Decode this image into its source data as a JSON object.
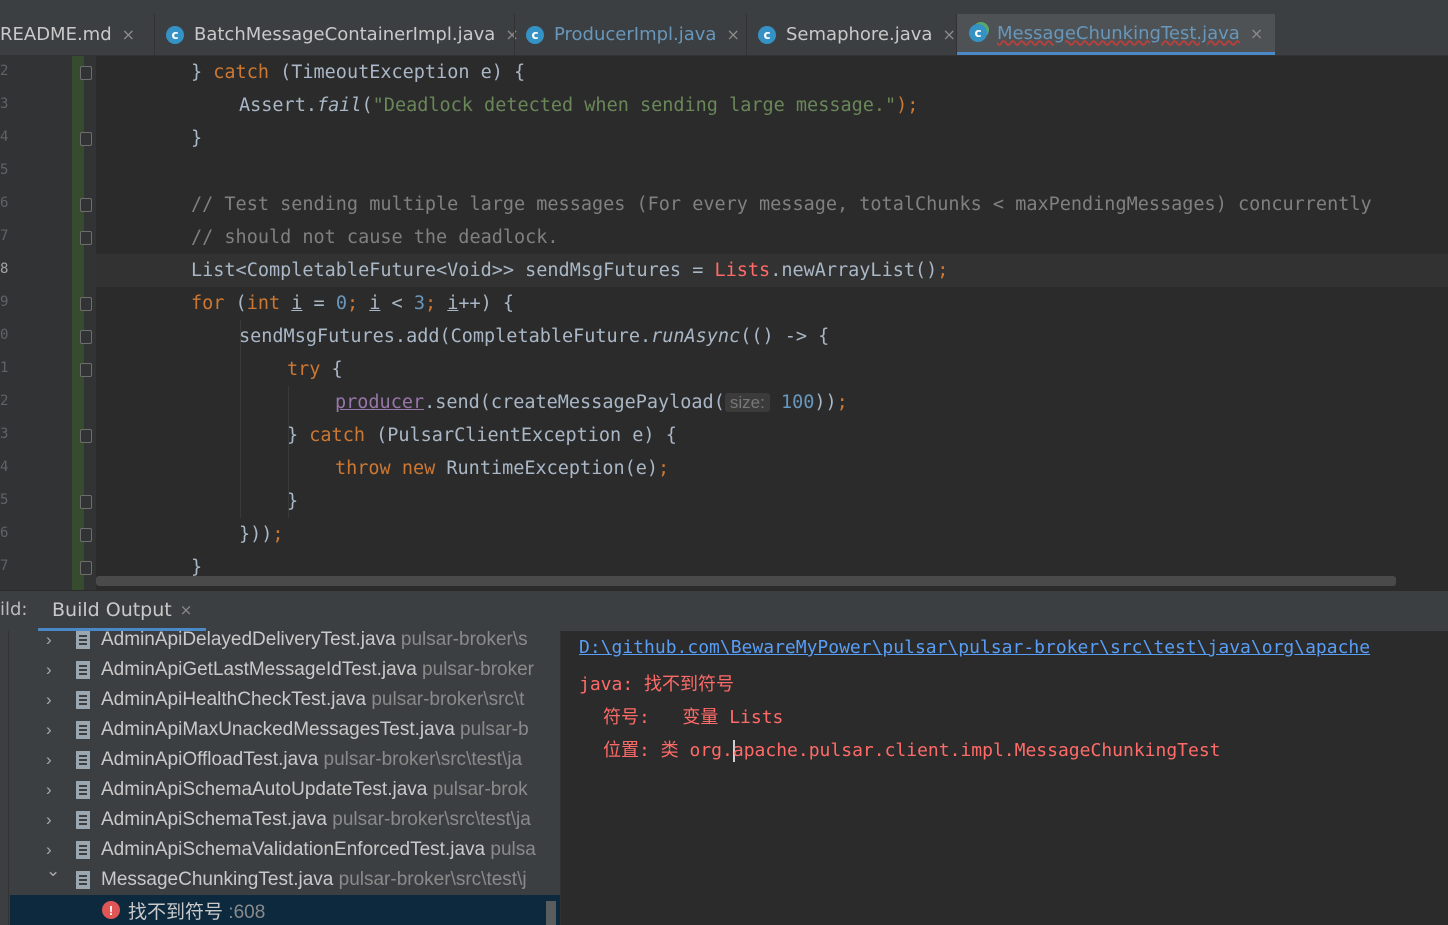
{
  "tabs": [
    {
      "label": "README.md",
      "icon": "markdown-icon"
    },
    {
      "label": "BatchMessageContainerImpl.java",
      "icon": "class-icon"
    },
    {
      "label": "ProducerImpl.java",
      "icon": "class-icon"
    },
    {
      "label": "Semaphore.java",
      "icon": "class-icon"
    },
    {
      "label": "MessageChunkingTest.java",
      "icon": "test-class-icon",
      "active": true
    }
  ],
  "tab_close": "×",
  "gutter": {
    "line_numbers": [
      "2",
      "3",
      "4",
      "5",
      "6",
      "7",
      "8",
      "9",
      "0",
      "1",
      "2",
      "3",
      "4",
      "5",
      "6",
      "7"
    ],
    "current_line_index": 6
  },
  "code": {
    "l1_close": "} ",
    "l1_catch": "catch",
    "l1_rest": " (TimeoutException e) {",
    "l2_assert": "Assert.",
    "l2_fail": "fail",
    "l2_paren": "(",
    "l2_str": "\"Deadlock detected when sending large message.\"",
    "l2_end": ");",
    "l3": "}",
    "l5": "// Test sending multiple large messages (For every message, totalChunks < maxPendingMessages) concurrently",
    "l6": "// should not cause the deadlock.",
    "l7_a": "List<CompletableFuture<Void>> sendMsgFutures = ",
    "l7_lists": "Lists",
    "l7_b": ".newArrayList()",
    "l7_semi": ";",
    "l8_for": "for",
    "l8_a": " (",
    "l8_int": "int",
    "l8_sp": " ",
    "l8_i1": "i",
    "l8_eq": " = ",
    "l8_zero": "0",
    "l8_s1": "; ",
    "l8_i2": "i",
    "l8_lt": " < ",
    "l8_three": "3",
    "l8_s2": "; ",
    "l8_i3": "i",
    "l8_end": "++) {",
    "l9_a": "sendMsgFutures.add(CompletableFuture.",
    "l9_run": "runAsync",
    "l9_b": "(() -> {",
    "l10_try": "try",
    "l10_b": " {",
    "l11_producer": "producer",
    "l11_a": ".send(createMessagePayload(",
    "l11_hint": "size:",
    "l11_num": "100",
    "l11_b": "))",
    "l11_semi": ";",
    "l12_a": "} ",
    "l12_catch": "catch",
    "l12_b": " (PulsarClientException e) {",
    "l13_throw": "throw",
    "l13_new": " new",
    "l13_a": " RuntimeException(e)",
    "l13_semi": ";",
    "l14": "}",
    "l15_a": "}))",
    "l15_semi": ";",
    "l16": "}"
  },
  "build": {
    "label": "ild:",
    "tab_label": "Build Output",
    "tab_close": "×"
  },
  "tree": {
    "items": [
      {
        "name": "AdminApiDelayedDeliveryTest.java",
        "path": " pulsar-broker\\s"
      },
      {
        "name": "AdminApiGetLastMessageIdTest.java",
        "path": " pulsar-broker"
      },
      {
        "name": "AdminApiHealthCheckTest.java",
        "path": " pulsar-broker\\src\\t"
      },
      {
        "name": "AdminApiMaxUnackedMessagesTest.java",
        "path": " pulsar-b"
      },
      {
        "name": "AdminApiOffloadTest.java",
        "path": " pulsar-broker\\src\\test\\ja"
      },
      {
        "name": "AdminApiSchemaAutoUpdateTest.java",
        "path": " pulsar-brok"
      },
      {
        "name": "AdminApiSchemaTest.java",
        "path": " pulsar-broker\\src\\test\\ja"
      },
      {
        "name": "AdminApiSchemaValidationEnforcedTest.java",
        "path": " pulsa"
      },
      {
        "name": "MessageChunkingTest.java",
        "path": " pulsar-broker\\src\\test\\j",
        "expanded": true
      }
    ],
    "collapsed_arrow": "›",
    "expanded_arrow": "⌄",
    "error_item": {
      "icon": "!",
      "text": "找不到符号",
      "line": " :608"
    }
  },
  "console": {
    "path": "D:\\github.com\\BewareMyPower\\pulsar\\pulsar-broker\\src\\test\\java\\org\\apache",
    "line1": "java: 找不到符号",
    "line2_label": "符号:   ",
    "line2_value": "变量 Lists",
    "line3_label": "位置: 类 org.",
    "line3_value": "apache.pulsar.client.impl.MessageChunkingTest"
  }
}
